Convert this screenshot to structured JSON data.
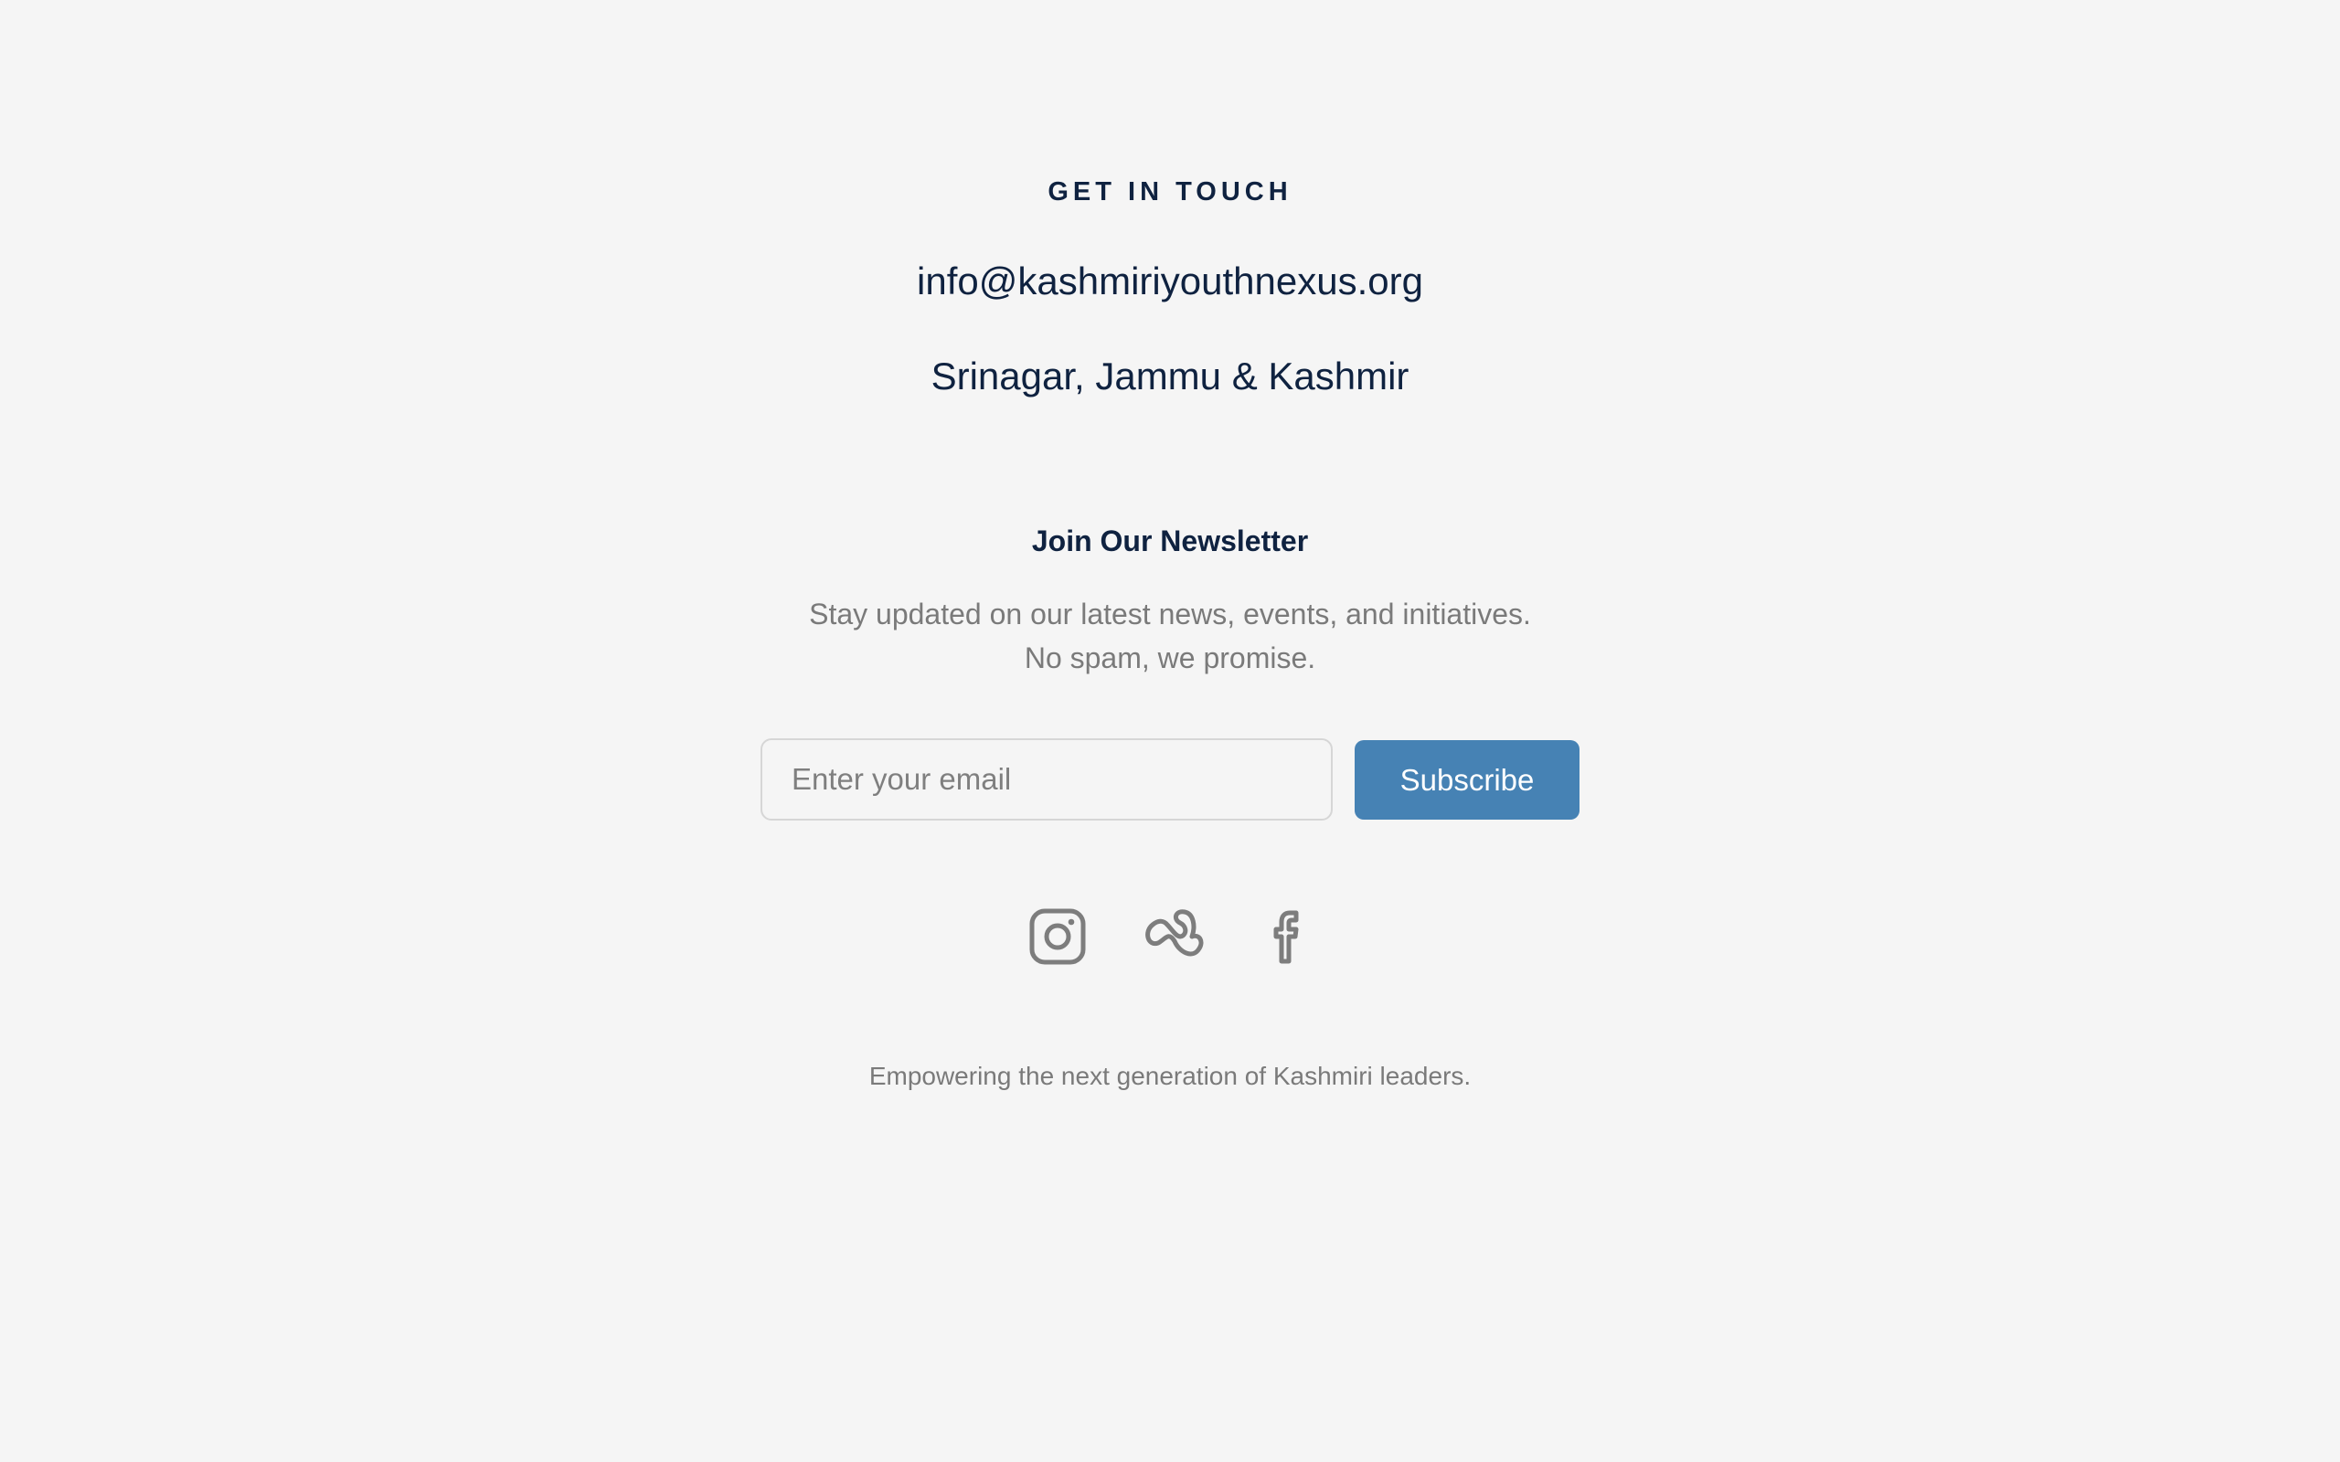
{
  "contact": {
    "heading": "GET IN TOUCH",
    "email": "info@kashmiriyouthnexus.org",
    "location": "Srinagar, Jammu & Kashmir"
  },
  "newsletter": {
    "title": "Join Our Newsletter",
    "description": "Stay updated on our latest news, events, and initiatives. No spam, we promise.",
    "email_placeholder": "Enter your email",
    "subscribe_label": "Subscribe"
  },
  "social": {
    "icons": [
      "instagram-icon",
      "threads-icon",
      "facebook-icon"
    ]
  },
  "footer": {
    "tagline": "Empowering the next generation of Kashmiri leaders."
  },
  "colors": {
    "background": "#f5f5f5",
    "heading_text": "#0f2240",
    "muted_text": "#7a7a7a",
    "accent": "#4682b4",
    "icon_stroke": "#7d7d7d"
  }
}
